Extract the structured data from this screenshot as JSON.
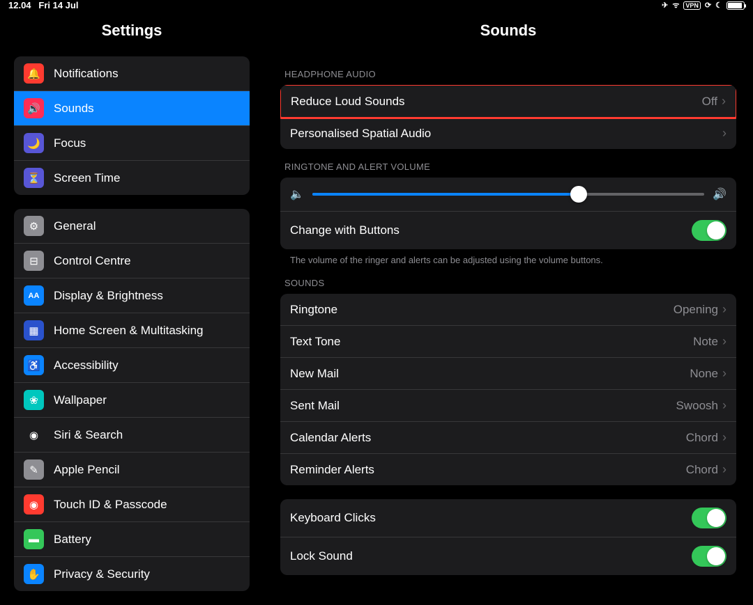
{
  "status": {
    "time": "12.04",
    "date": "Fri 14 Jul"
  },
  "sidebar": {
    "title": "Settings",
    "group1": [
      {
        "label": "Notifications",
        "icon": "🔔",
        "bg": "#ff3b30"
      },
      {
        "label": "Sounds",
        "icon": "🔊",
        "bg": "#ff2d55",
        "selected": true
      },
      {
        "label": "Focus",
        "icon": "🌙",
        "bg": "#5856d6"
      },
      {
        "label": "Screen Time",
        "icon": "⏳",
        "bg": "#5856d6"
      }
    ],
    "group2": [
      {
        "label": "General",
        "icon": "⚙",
        "bg": "#8e8e93"
      },
      {
        "label": "Control Centre",
        "icon": "⊟",
        "bg": "#8e8e93"
      },
      {
        "label": "Display & Brightness",
        "icon": "AA",
        "bg": "#0a84ff"
      },
      {
        "label": "Home Screen & Multitasking",
        "icon": "▦",
        "bg": "#2a52cc"
      },
      {
        "label": "Accessibility",
        "icon": "♿",
        "bg": "#0a84ff"
      },
      {
        "label": "Wallpaper",
        "icon": "❀",
        "bg": "#00c7be"
      },
      {
        "label": "Siri & Search",
        "icon": "◉",
        "bg": "#1c1c1e"
      },
      {
        "label": "Apple Pencil",
        "icon": "✎",
        "bg": "#8e8e93"
      },
      {
        "label": "Touch ID & Passcode",
        "icon": "◉",
        "bg": "#ff3b30"
      },
      {
        "label": "Battery",
        "icon": "▬",
        "bg": "#34c759"
      },
      {
        "label": "Privacy & Security",
        "icon": "✋",
        "bg": "#0a84ff"
      }
    ]
  },
  "content": {
    "title": "Sounds",
    "headphone_header": "HEADPHONE AUDIO",
    "reduce_loud": "Reduce Loud Sounds",
    "reduce_loud_val": "Off",
    "spatial": "Personalised Spatial Audio",
    "ringtone_header": "RINGTONE AND ALERT VOLUME",
    "change_buttons": "Change with Buttons",
    "change_buttons_note": "The volume of the ringer and alerts can be adjusted using the volume buttons.",
    "sounds_header": "SOUNDS",
    "sound_items": [
      {
        "label": "Ringtone",
        "value": "Opening"
      },
      {
        "label": "Text Tone",
        "value": "Note"
      },
      {
        "label": "New Mail",
        "value": "None"
      },
      {
        "label": "Sent Mail",
        "value": "Swoosh"
      },
      {
        "label": "Calendar Alerts",
        "value": "Chord"
      },
      {
        "label": "Reminder Alerts",
        "value": "Chord"
      }
    ],
    "keyboard_clicks": "Keyboard Clicks",
    "lock_sound": "Lock Sound"
  }
}
